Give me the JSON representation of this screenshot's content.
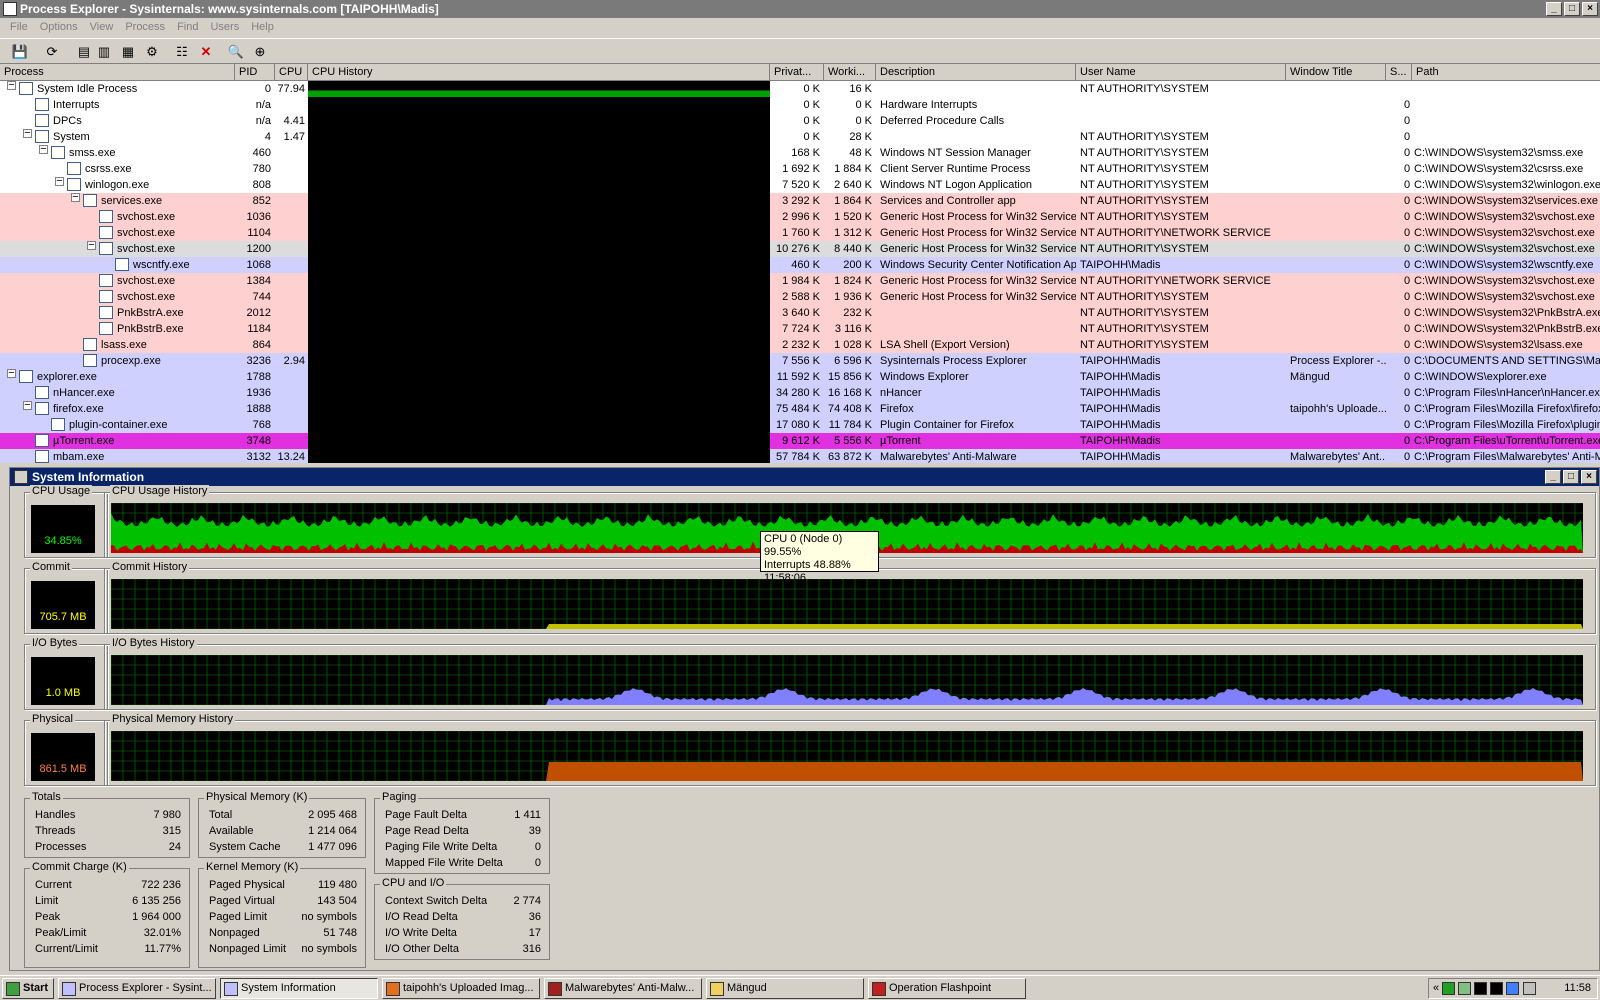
{
  "window": {
    "title": "Process Explorer - Sysinternals: www.sysinternals.com [TAIPOHH\\Madis]"
  },
  "menu": [
    "File",
    "Options",
    "View",
    "Process",
    "Find",
    "Users",
    "Help"
  ],
  "columns": {
    "process": "Process",
    "pid": "PID",
    "cpu": "CPU",
    "history": "CPU History",
    "private": "Privat...",
    "working": "Worki...",
    "description": "Description",
    "user": "User Name",
    "wtitle": "Window Title",
    "s": "S...",
    "path": "Path"
  },
  "processes": [
    {
      "name": "System Idle Process",
      "pid": "0",
      "cpu": "77.94",
      "priv": "0 K",
      "work": "16 K",
      "desc": "",
      "user": "NT AUTHORITY\\SYSTEM",
      "wt": "",
      "s": "",
      "path": "",
      "bg": "#ffffff",
      "indent": 0
    },
    {
      "name": "Interrupts",
      "pid": "n/a",
      "cpu": "",
      "priv": "0 K",
      "work": "0 K",
      "desc": "Hardware Interrupts",
      "user": "",
      "wt": "",
      "s": "0",
      "path": "",
      "bg": "#ffffff",
      "indent": 1
    },
    {
      "name": "DPCs",
      "pid": "n/a",
      "cpu": "4.41",
      "priv": "0 K",
      "work": "0 K",
      "desc": "Deferred Procedure Calls",
      "user": "",
      "wt": "",
      "s": "0",
      "path": "",
      "bg": "#ffffff",
      "indent": 1
    },
    {
      "name": "System",
      "pid": "4",
      "cpu": "1.47",
      "priv": "0 K",
      "work": "28 K",
      "desc": "",
      "user": "NT AUTHORITY\\SYSTEM",
      "wt": "",
      "s": "0",
      "path": "",
      "bg": "#ffffff",
      "indent": 1
    },
    {
      "name": "smss.exe",
      "pid": "460",
      "cpu": "",
      "priv": "168 K",
      "work": "48 K",
      "desc": "Windows NT Session Manager",
      "user": "NT AUTHORITY\\SYSTEM",
      "wt": "",
      "s": "0",
      "path": "C:\\WINDOWS\\system32\\smss.exe",
      "bg": "#ffffff",
      "indent": 2
    },
    {
      "name": "csrss.exe",
      "pid": "780",
      "cpu": "",
      "priv": "1 692 K",
      "work": "1 884 K",
      "desc": "Client Server Runtime Process",
      "user": "NT AUTHORITY\\SYSTEM",
      "wt": "",
      "s": "0",
      "path": "C:\\WINDOWS\\system32\\csrss.exe",
      "bg": "#ffffff",
      "indent": 3
    },
    {
      "name": "winlogon.exe",
      "pid": "808",
      "cpu": "",
      "priv": "7 520 K",
      "work": "2 640 K",
      "desc": "Windows NT Logon Application",
      "user": "NT AUTHORITY\\SYSTEM",
      "wt": "",
      "s": "0",
      "path": "C:\\WINDOWS\\system32\\winlogon.exe",
      "bg": "#ffffff",
      "indent": 3
    },
    {
      "name": "services.exe",
      "pid": "852",
      "cpu": "",
      "priv": "3 292 K",
      "work": "1 864 K",
      "desc": "Services and Controller app",
      "user": "NT AUTHORITY\\SYSTEM",
      "wt": "",
      "s": "0",
      "path": "C:\\WINDOWS\\system32\\services.exe",
      "bg": "#ffd0d0",
      "indent": 4
    },
    {
      "name": "svchost.exe",
      "pid": "1036",
      "cpu": "",
      "priv": "2 996 K",
      "work": "1 520 K",
      "desc": "Generic Host Process for Win32 Services",
      "user": "NT AUTHORITY\\SYSTEM",
      "wt": "",
      "s": "0",
      "path": "C:\\WINDOWS\\system32\\svchost.exe",
      "bg": "#ffd0d0",
      "indent": 5
    },
    {
      "name": "svchost.exe",
      "pid": "1104",
      "cpu": "",
      "priv": "1 760 K",
      "work": "1 312 K",
      "desc": "Generic Host Process for Win32 Services",
      "user": "NT AUTHORITY\\NETWORK SERVICE",
      "wt": "",
      "s": "0",
      "path": "C:\\WINDOWS\\system32\\svchost.exe",
      "bg": "#ffd0d0",
      "indent": 5
    },
    {
      "name": "svchost.exe",
      "pid": "1200",
      "cpu": "",
      "priv": "10 276 K",
      "work": "8 440 K",
      "desc": "Generic Host Process for Win32 Services",
      "user": "NT AUTHORITY\\SYSTEM",
      "wt": "",
      "s": "0",
      "path": "C:\\WINDOWS\\system32\\svchost.exe",
      "bg": "#dcdcdc",
      "indent": 5
    },
    {
      "name": "wscntfy.exe",
      "pid": "1068",
      "cpu": "",
      "priv": "460 K",
      "work": "200 K",
      "desc": "Windows Security Center Notification App",
      "user": "TAIPOHH\\Madis",
      "wt": "",
      "s": "0",
      "path": "C:\\WINDOWS\\system32\\wscntfy.exe",
      "bg": "#d0d0ff",
      "indent": 6
    },
    {
      "name": "svchost.exe",
      "pid": "1384",
      "cpu": "",
      "priv": "1 984 K",
      "work": "1 824 K",
      "desc": "Generic Host Process for Win32 Services",
      "user": "NT AUTHORITY\\NETWORK SERVICE",
      "wt": "",
      "s": "0",
      "path": "C:\\WINDOWS\\system32\\svchost.exe",
      "bg": "#ffd0d0",
      "indent": 5
    },
    {
      "name": "svchost.exe",
      "pid": "744",
      "cpu": "",
      "priv": "2 588 K",
      "work": "1 936 K",
      "desc": "Generic Host Process for Win32 Services",
      "user": "NT AUTHORITY\\SYSTEM",
      "wt": "",
      "s": "0",
      "path": "C:\\WINDOWS\\system32\\svchost.exe",
      "bg": "#ffd0d0",
      "indent": 5
    },
    {
      "name": "PnkBstrA.exe",
      "pid": "2012",
      "cpu": "",
      "priv": "3 640 K",
      "work": "232 K",
      "desc": "",
      "user": "NT AUTHORITY\\SYSTEM",
      "wt": "",
      "s": "0",
      "path": "C:\\WINDOWS\\system32\\PnkBstrA.exe",
      "bg": "#ffd0d0",
      "indent": 5
    },
    {
      "name": "PnkBstrB.exe",
      "pid": "1184",
      "cpu": "",
      "priv": "7 724 K",
      "work": "3 116 K",
      "desc": "",
      "user": "NT AUTHORITY\\SYSTEM",
      "wt": "",
      "s": "0",
      "path": "C:\\WINDOWS\\system32\\PnkBstrB.exe",
      "bg": "#ffd0d0",
      "indent": 5
    },
    {
      "name": "lsass.exe",
      "pid": "864",
      "cpu": "",
      "priv": "2 232 K",
      "work": "1 028 K",
      "desc": "LSA Shell (Export Version)",
      "user": "NT AUTHORITY\\SYSTEM",
      "wt": "",
      "s": "0",
      "path": "C:\\WINDOWS\\system32\\lsass.exe",
      "bg": "#ffd0d0",
      "indent": 4
    },
    {
      "name": "procexp.exe",
      "pid": "3236",
      "cpu": "2.94",
      "priv": "7 556 K",
      "work": "6 596 K",
      "desc": "Sysinternals Process Explorer",
      "user": "TAIPOHH\\Madis",
      "wt": "Process Explorer -...",
      "s": "0",
      "path": "C:\\DOCUMENTS AND SETTINGS\\Ma",
      "bg": "#d0d0ff",
      "indent": 4
    },
    {
      "name": "explorer.exe",
      "pid": "1788",
      "cpu": "",
      "priv": "11 592 K",
      "work": "15 856 K",
      "desc": "Windows Explorer",
      "user": "TAIPOHH\\Madis",
      "wt": "Mängud",
      "s": "0",
      "path": "C:\\WINDOWS\\explorer.exe",
      "bg": "#d0d0ff",
      "indent": 0
    },
    {
      "name": "nHancer.exe",
      "pid": "1936",
      "cpu": "",
      "priv": "34 280 K",
      "work": "16 168 K",
      "desc": "nHancer",
      "user": "TAIPOHH\\Madis",
      "wt": "",
      "s": "0",
      "path": "C:\\Program Files\\nHancer\\nHancer.exe",
      "bg": "#d0d0ff",
      "indent": 1
    },
    {
      "name": "firefox.exe",
      "pid": "1888",
      "cpu": "",
      "priv": "75 484 K",
      "work": "74 408 K",
      "desc": "Firefox",
      "user": "TAIPOHH\\Madis",
      "wt": "taipohh's Uploade...",
      "s": "0",
      "path": "C:\\Program Files\\Mozilla Firefox\\firefox.",
      "bg": "#d0d0ff",
      "indent": 1
    },
    {
      "name": "plugin-container.exe",
      "pid": "768",
      "cpu": "",
      "priv": "17 080 K",
      "work": "11 784 K",
      "desc": "Plugin Container for Firefox",
      "user": "TAIPOHH\\Madis",
      "wt": "",
      "s": "0",
      "path": "C:\\Program Files\\Mozilla Firefox\\plugin-",
      "bg": "#d0d0ff",
      "indent": 2
    },
    {
      "name": "µTorrent.exe",
      "pid": "3748",
      "cpu": "",
      "priv": "9 612 K",
      "work": "5 556 K",
      "desc": "µTorrent",
      "user": "TAIPOHH\\Madis",
      "wt": "",
      "s": "0",
      "path": "C:\\Program Files\\uTorrent\\uTorrent.exe",
      "bg": "#e030e0",
      "indent": 1
    },
    {
      "name": "mbam.exe",
      "pid": "3132",
      "cpu": "13.24",
      "priv": "57 784 K",
      "work": "63 872 K",
      "desc": "Malwarebytes' Anti-Malware",
      "user": "TAIPOHH\\Madis",
      "wt": "Malwarebytes' Ant...",
      "s": "0",
      "path": "C:\\Program Files\\Malwarebytes' Anti-Ma",
      "bg": "#d0d0ff",
      "indent": 1
    }
  ],
  "sysinfo": {
    "title": "System Information",
    "cpu_usage_label": "CPU Usage",
    "cpu_usage_value": "34.85%",
    "cpu_history_label": "CPU Usage History",
    "commit_label": "Commit",
    "commit_value": "705.7 MB",
    "commit_history_label": "Commit History",
    "io_label": "I/O Bytes",
    "io_value": "1.0 MB",
    "io_history_label": "I/O Bytes History",
    "physical_label": "Physical",
    "physical_value": "861.5 MB",
    "physical_history_label": "Physical Memory History",
    "tooltip": {
      "line1": "CPU 0 (Node 0) 99.55%",
      "line2": "Interrupts 48.88%",
      "line3": "11:58:06"
    }
  },
  "totals": {
    "title": "Totals",
    "rows": [
      [
        "Handles",
        "7 980"
      ],
      [
        "Threads",
        "315"
      ],
      [
        "Processes",
        "24"
      ]
    ]
  },
  "commit_charge": {
    "title": "Commit Charge (K)",
    "rows": [
      [
        "Current",
        "722 236"
      ],
      [
        "Limit",
        "6 135 256"
      ],
      [
        "Peak",
        "1 964 000"
      ],
      [
        "Peak/Limit",
        "32.01%"
      ],
      [
        "Current/Limit",
        "11.77%"
      ]
    ]
  },
  "physical_memory": {
    "title": "Physical Memory (K)",
    "rows": [
      [
        "Total",
        "2 095 468"
      ],
      [
        "Available",
        "1 214 064"
      ],
      [
        "System Cache",
        "1 477 096"
      ]
    ]
  },
  "kernel_memory": {
    "title": "Kernel Memory (K)",
    "rows": [
      [
        "Paged Physical",
        "119 480"
      ],
      [
        "Paged Virtual",
        "143 504"
      ],
      [
        "Paged Limit",
        "no symbols"
      ],
      [
        "Nonpaged",
        "51 748"
      ],
      [
        "Nonpaged Limit",
        "no symbols"
      ]
    ]
  },
  "paging": {
    "title": "Paging",
    "rows": [
      [
        "Page Fault Delta",
        "1 411"
      ],
      [
        "Page Read Delta",
        "39"
      ],
      [
        "Paging File Write Delta",
        "0"
      ],
      [
        "Mapped File Write Delta",
        "0"
      ]
    ]
  },
  "cpu_io": {
    "title": "CPU and I/O",
    "rows": [
      [
        "Context Switch Delta",
        "2 774"
      ],
      [
        "I/O Read Delta",
        "36"
      ],
      [
        "I/O Write Delta",
        "17"
      ],
      [
        "I/O Other Delta",
        "316"
      ]
    ]
  },
  "taskbar": {
    "start": "Start",
    "tasks": [
      "Process Explorer - Sysint...",
      "System Information",
      "taipohh's Uploaded Imag...",
      "Malwarebytes' Anti-Malw...",
      "Mängud",
      "Operation Flashpoint"
    ],
    "clock": "11:58"
  },
  "colors": {
    "graph_green": "#00c000",
    "graph_red": "#c00000",
    "commit_yellow": "#c0c000",
    "io_blue": "#8080ff",
    "phys_orange": "#c05000",
    "grid": "#008000"
  }
}
